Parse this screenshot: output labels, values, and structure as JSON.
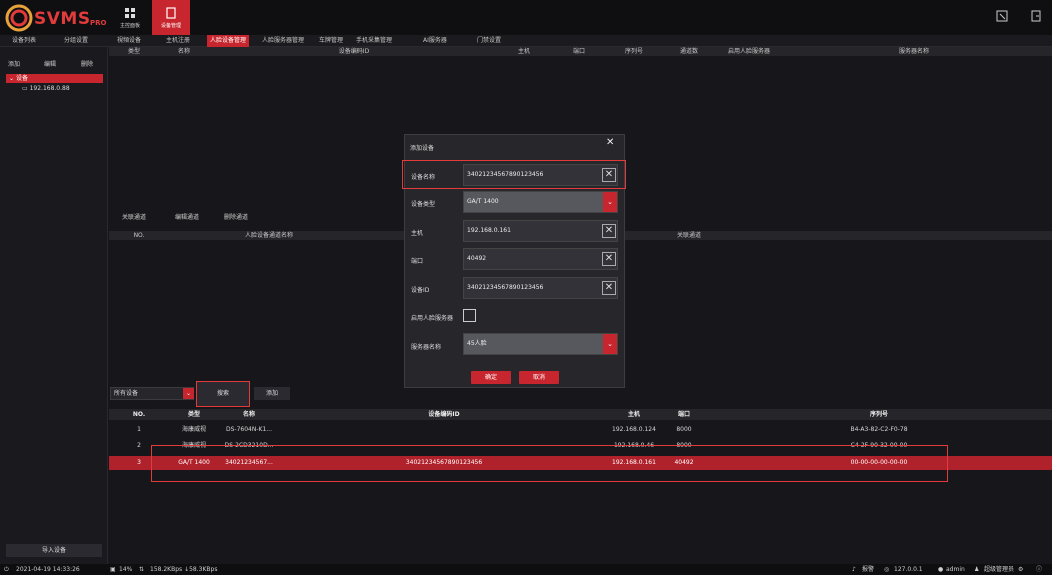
{
  "app": {
    "logo": "SVMS",
    "logo_suffix": "PRO",
    "accent": "#c8262e"
  },
  "top_tabs": [
    {
      "label": "主控面板"
    },
    {
      "label": "设备管理"
    }
  ],
  "menu": {
    "left": [
      "设备列表",
      "分组设置"
    ],
    "items": [
      "視頻设备",
      "主机注册",
      "人脸设备管理",
      "人脸服务器管理",
      "车牌管理",
      "手机采集管理",
      "AI服务器",
      "门禁设置"
    ]
  },
  "sidebar": {
    "tools": [
      "添加",
      "编辑",
      "删除"
    ],
    "root": "设备",
    "child": "192.168.0.88",
    "import_label": "导入设备"
  },
  "top_table": {
    "headers": [
      "类型",
      "名称",
      "设备编码ID",
      "主机",
      "端口",
      "序列号",
      "通道数",
      "启用人脸服务器",
      "服务器名称"
    ]
  },
  "channel": {
    "tools": [
      "关联通道",
      "编辑通道",
      "删除通道"
    ],
    "headers": [
      "NO.",
      "人脸设备通道名称",
      "关联通道"
    ]
  },
  "search": {
    "select_value": "所有设备",
    "search_label": "搜索",
    "add_label": "添加"
  },
  "results": {
    "headers": [
      "NO.",
      "类型",
      "名称",
      "设备编码ID",
      "主机",
      "端口",
      "序列号"
    ],
    "rows": [
      [
        "1",
        "海康威视",
        "DS-7604N-K1...",
        "",
        "192.168.0.124",
        "8000",
        "B4-A3-82-C2-F0-78"
      ],
      [
        "2",
        "海康威视",
        "DS-2CD3210D...",
        "",
        "192.168.0.46",
        "8000",
        "C4-2F-90-32-00-00"
      ],
      [
        "3",
        "GA/T 1400",
        "34021234567...",
        "34021234567890123456",
        "192.168.0.161",
        "40492",
        "00-00-00-00-00-00"
      ]
    ]
  },
  "dialog": {
    "title": "添加设备",
    "fields": [
      {
        "label": "设备名称",
        "value": "34021234567890123456"
      },
      {
        "label": "设备类型",
        "value": "GA/T 1400"
      },
      {
        "label": "主机",
        "value": "192.168.0.161"
      },
      {
        "label": "端口",
        "value": "40492"
      },
      {
        "label": "设备ID",
        "value": "34021234567890123456"
      },
      {
        "label": "启用人脸服务器",
        "value": ""
      },
      {
        "label": "服务器名称",
        "value": "45人脸"
      }
    ],
    "ok": "确定",
    "cancel": "取消"
  },
  "status": {
    "datetime": "2021-04-19 14:33:26",
    "cpu": "14%",
    "net": "158.2KBps ↓58.3KBps",
    "alarm": "报警",
    "ip": "127.0.0.1",
    "user": "admin",
    "role": "超级管理员"
  }
}
